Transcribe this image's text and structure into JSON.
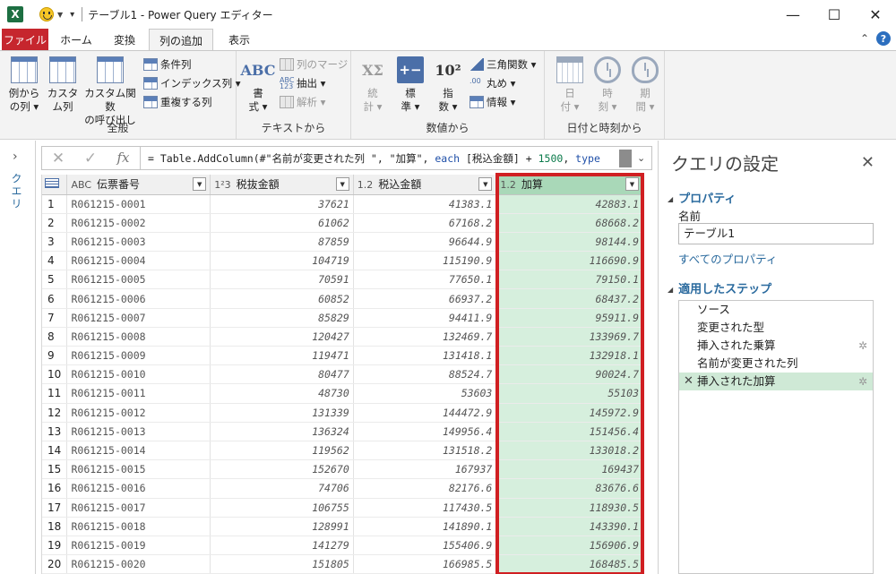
{
  "window": {
    "title": "テーブル1 - Power Query エディター",
    "app_icon": "excel-icon",
    "minimize": "—",
    "maximize": "☐",
    "close": "✕"
  },
  "tabs": [
    "ファイル",
    "ホーム",
    "変換",
    "列の追加",
    "表示"
  ],
  "active_tab": "列の追加",
  "ribbon": {
    "general": {
      "label": "全般",
      "example_btn": [
        "例から",
        "の列 ▾"
      ],
      "custom_btn": [
        "カスタ",
        "ム列"
      ],
      "invoke_btn": [
        "カスタム関数",
        "の呼び出し"
      ],
      "conditional": "条件列",
      "index": "インデックス列 ▾",
      "duplicate": "重複する列"
    },
    "text": {
      "label": "テキストから",
      "format_btn": [
        "書",
        "式 ▾"
      ],
      "merge": "列のマージ",
      "extract": "抽出 ▾",
      "parse": "解析 ▾"
    },
    "number": {
      "label": "数値から",
      "stats_btn": [
        "統",
        "計 ▾"
      ],
      "standard_btn": [
        "標",
        "準 ▾"
      ],
      "sci_btn": [
        "指",
        "数 ▾"
      ],
      "trig": "三角関数 ▾",
      "round": "丸め ▾",
      "info": "情報 ▾"
    },
    "datetime": {
      "label": "日付と時刻から",
      "date_btn": [
        "日",
        "付 ▾"
      ],
      "time_btn": [
        "時",
        "刻 ▾"
      ],
      "duration_btn": [
        "期",
        "間 ▾"
      ]
    }
  },
  "left_pane": {
    "label": "クエリ"
  },
  "formula": {
    "prefix": "= Table.AddColumn(#\"名前が変更された列 \", \"加算\", ",
    "kw": "each",
    "mid": " [税込金額] + ",
    "num": "1500",
    "suffix": ", ",
    "kw2": "type"
  },
  "columns": [
    {
      "type": "ABC",
      "name": "伝票番号"
    },
    {
      "type": "1²3",
      "name": "税抜金額"
    },
    {
      "type": "1.2",
      "name": "税込金額"
    },
    {
      "type": "1.2",
      "name": "加算"
    }
  ],
  "rows": [
    [
      "R061215-0001",
      "37621",
      "41383.1",
      "42883.1"
    ],
    [
      "R061215-0002",
      "61062",
      "67168.2",
      "68668.2"
    ],
    [
      "R061215-0003",
      "87859",
      "96644.9",
      "98144.9"
    ],
    [
      "R061215-0004",
      "104719",
      "115190.9",
      "116690.9"
    ],
    [
      "R061215-0005",
      "70591",
      "77650.1",
      "79150.1"
    ],
    [
      "R061215-0006",
      "60852",
      "66937.2",
      "68437.2"
    ],
    [
      "R061215-0007",
      "85829",
      "94411.9",
      "95911.9"
    ],
    [
      "R061215-0008",
      "120427",
      "132469.7",
      "133969.7"
    ],
    [
      "R061215-0009",
      "119471",
      "131418.1",
      "132918.1"
    ],
    [
      "R061215-0010",
      "80477",
      "88524.7",
      "90024.7"
    ],
    [
      "R061215-0011",
      "48730",
      "53603",
      "55103"
    ],
    [
      "R061215-0012",
      "131339",
      "144472.9",
      "145972.9"
    ],
    [
      "R061215-0013",
      "136324",
      "149956.4",
      "151456.4"
    ],
    [
      "R061215-0014",
      "119562",
      "131518.2",
      "133018.2"
    ],
    [
      "R061215-0015",
      "152670",
      "167937",
      "169437"
    ],
    [
      "R061215-0016",
      "74706",
      "82176.6",
      "83676.6"
    ],
    [
      "R061215-0017",
      "106755",
      "117430.5",
      "118930.5"
    ],
    [
      "R061215-0018",
      "128991",
      "141890.1",
      "143390.1"
    ],
    [
      "R061215-0019",
      "141279",
      "155406.9",
      "156906.9"
    ],
    [
      "R061215-0020",
      "151805",
      "166985.5",
      "168485.5"
    ]
  ],
  "settings": {
    "title": "クエリの設定",
    "properties": "プロパティ",
    "name_label": "名前",
    "name_value": "テーブル1",
    "all_props": "すべてのプロパティ",
    "steps_label": "適用したステップ",
    "steps": [
      "ソース",
      "変更された型",
      "挿入された乗算",
      "名前が変更された列",
      "挿入された加算"
    ],
    "active_step": "挿入された加算"
  },
  "colors": {
    "accent_green": "#d6efdd",
    "highlight_red": "#d01f22",
    "file_tab": "#c6262e"
  }
}
